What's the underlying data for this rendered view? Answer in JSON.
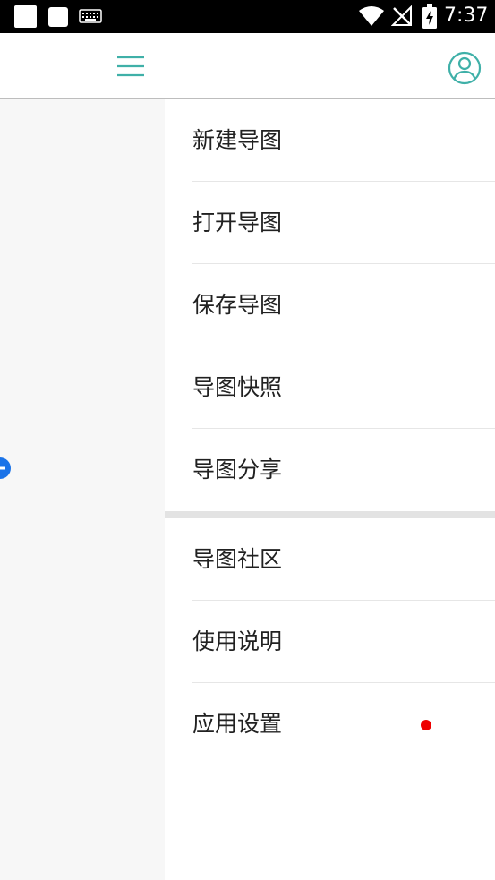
{
  "status_bar": {
    "time": "7:37",
    "icons": [
      "notification-square-icon",
      "notification-square-icon",
      "keyboard-icon",
      "wifi-icon",
      "no-signal-icon",
      "battery-charging-icon"
    ]
  },
  "header": {
    "menu_icon": "hamburger-menu-icon",
    "account_icon": "account-circle-icon",
    "accent_color": "#3fb0a8"
  },
  "drawer": {
    "group_primary": [
      {
        "label": "新建导图"
      },
      {
        "label": "打开导图"
      },
      {
        "label": "保存导图"
      },
      {
        "label": "导图快照"
      },
      {
        "label": "导图分享"
      }
    ],
    "group_secondary": [
      {
        "label": "导图社区"
      },
      {
        "label": "使用说明"
      },
      {
        "label": "应用设置",
        "badge": true
      }
    ],
    "badge_color": "#ee0000"
  },
  "canvas": {
    "node_icon": "collapse-node-icon",
    "node_color": "#1a73e8"
  }
}
